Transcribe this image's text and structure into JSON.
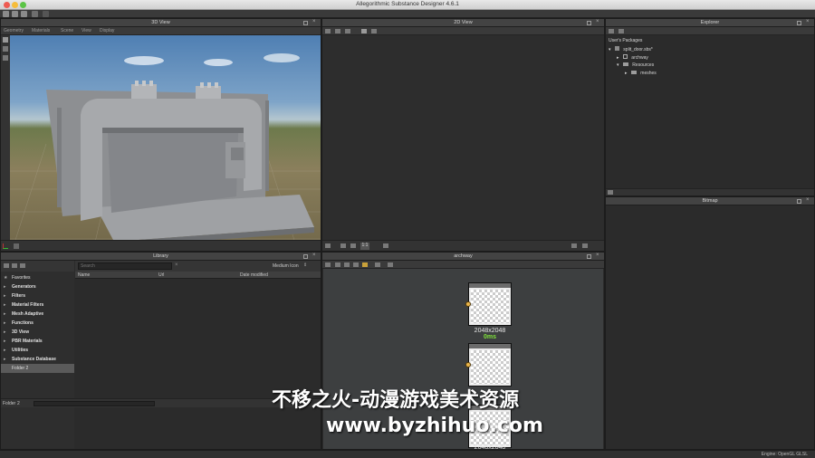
{
  "window": {
    "title": "Allegorithmic Substance Designer 4.6.1"
  },
  "panels": {
    "view3d": {
      "title": "3D View",
      "menu": [
        "Geometry",
        "Materials",
        "Scene",
        "View",
        "Display"
      ]
    },
    "view2d": {
      "title": "2D View",
      "zoom_value": "1:1"
    },
    "explorer": {
      "title": "Explorer",
      "header": "User's Packages",
      "tree": [
        {
          "label": "split_door.sbs*",
          "level": 0,
          "icon": "package-icon"
        },
        {
          "label": "archway",
          "level": 1,
          "icon": "graph-icon"
        },
        {
          "label": "Resources",
          "level": 1,
          "icon": "folder-icon"
        },
        {
          "label": "meshes",
          "level": 2,
          "icon": "folder-icon"
        }
      ]
    },
    "bitmap": {
      "title": "Bitmap"
    },
    "library": {
      "title": "Library",
      "search_placeholder": "Search",
      "view_mode": "Medium Icon",
      "columns": [
        "Name",
        "Url",
        "Date modified"
      ],
      "categories": [
        "Favorites",
        "Generators",
        "Filters",
        "Material Filters",
        "Mesh Adaptive",
        "Functions",
        "3D View",
        "PBR Materials",
        "Utilities",
        "Substance Database",
        "Folder 2"
      ],
      "folder_label": "Folder",
      "folder_value": "2"
    },
    "graph": {
      "title": "archway",
      "nodes": [
        {
          "label": "Output",
          "caption": "Node Color",
          "resolution": "2048x2048",
          "time": "0ms"
        },
        {
          "label": "Output",
          "caption": "Node Color",
          "resolution": "2048x2048",
          "time": ""
        },
        {
          "label": "Output",
          "caption": "",
          "resolution": "2048x2048",
          "time": ""
        }
      ]
    }
  },
  "statusbar": {
    "engine": "Engine: OpenGL GLSL"
  },
  "watermark": {
    "line1": "不移之火-动漫游戏美术资源",
    "line2": "www.byzhihuo.com"
  },
  "colors": {
    "accent_green": "#7fe23a",
    "socket_orange": "#e9b44c",
    "selection": "#5a5a5a"
  }
}
